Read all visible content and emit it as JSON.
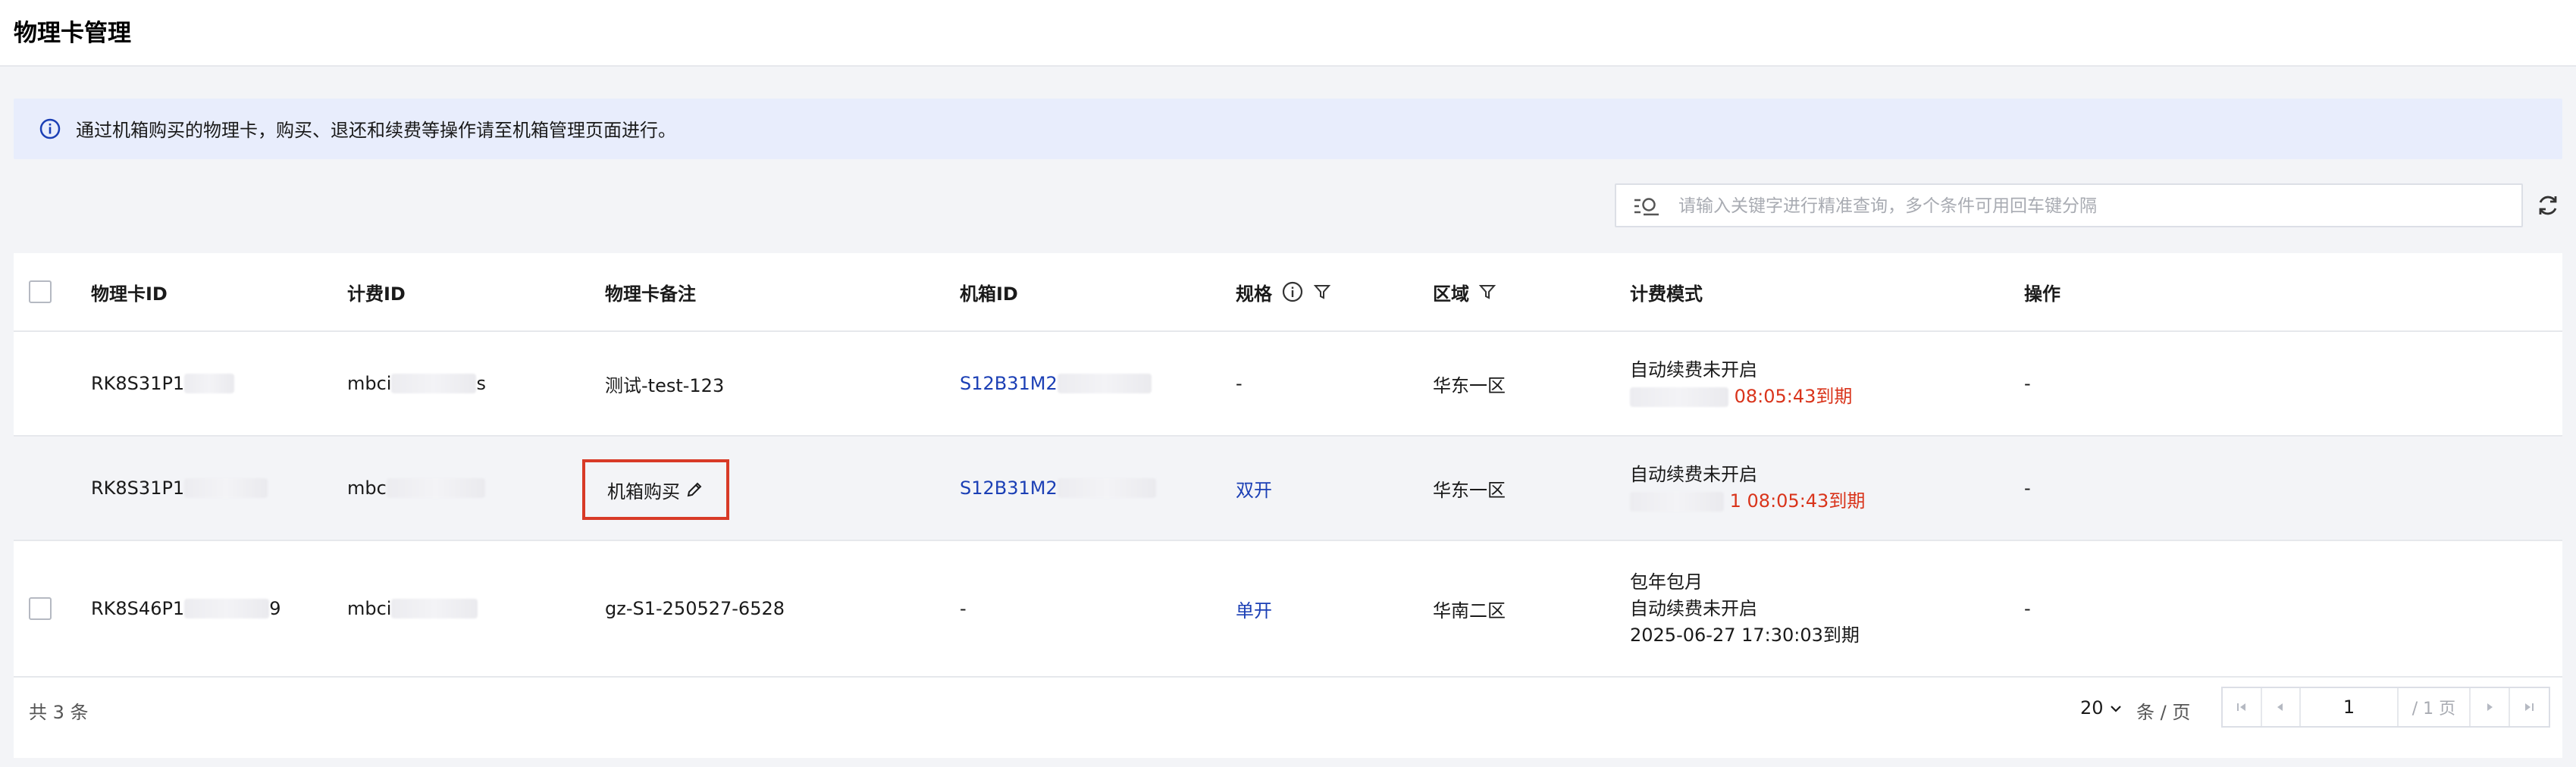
{
  "header": {
    "title": "物理卡管理"
  },
  "notice": {
    "text": "通过机箱购买的物理卡，购买、退还和续费等操作请至机箱管理页面进行。"
  },
  "search": {
    "placeholder": "请输入关键字进行精准查询，多个条件可用回车键分隔"
  },
  "table": {
    "columns": {
      "card_id": "物理卡ID",
      "billing_id": "计费ID",
      "remark": "物理卡备注",
      "chassis_id": "机箱ID",
      "spec": "规格",
      "region": "区域",
      "billing_mode": "计费模式",
      "action": "操作"
    },
    "rows": [
      {
        "card_id_prefix": "RK8S31P1",
        "billing_id_prefix": "mbci",
        "billing_id_suffix": "s",
        "remark": "测试-test-123",
        "chassis_id": "S12B31M2",
        "spec": "-",
        "region": "华东一区",
        "billing_line1": "自动续费未开启",
        "billing_expiry": "08:05:43到期",
        "action": "-"
      },
      {
        "card_id_prefix": "RK8S31P1",
        "billing_id_prefix": "mbc",
        "remark": "机箱购买",
        "chassis_id": "S12B31M2",
        "spec": "双开",
        "region": "华东一区",
        "billing_line1": "自动续费未开启",
        "billing_expiry": "1 08:05:43到期",
        "action": "-"
      },
      {
        "card_id_prefix": "RK8S46P1",
        "card_id_suffix": "9",
        "billing_id_prefix": "mbci",
        "remark": "gz-S1-250527-6528",
        "chassis_id": "-",
        "spec": "单开",
        "region": "华南二区",
        "billing_line0": "包年包月",
        "billing_line1": "自动续费未开启",
        "billing_expiry": "2025-06-27 17:30:03到期",
        "action": "-"
      }
    ]
  },
  "pagination": {
    "total": "共 3 条",
    "page_size": "20",
    "page_unit": "条 / 页",
    "current_page": "1",
    "total_pages": "/ 1 页"
  }
}
